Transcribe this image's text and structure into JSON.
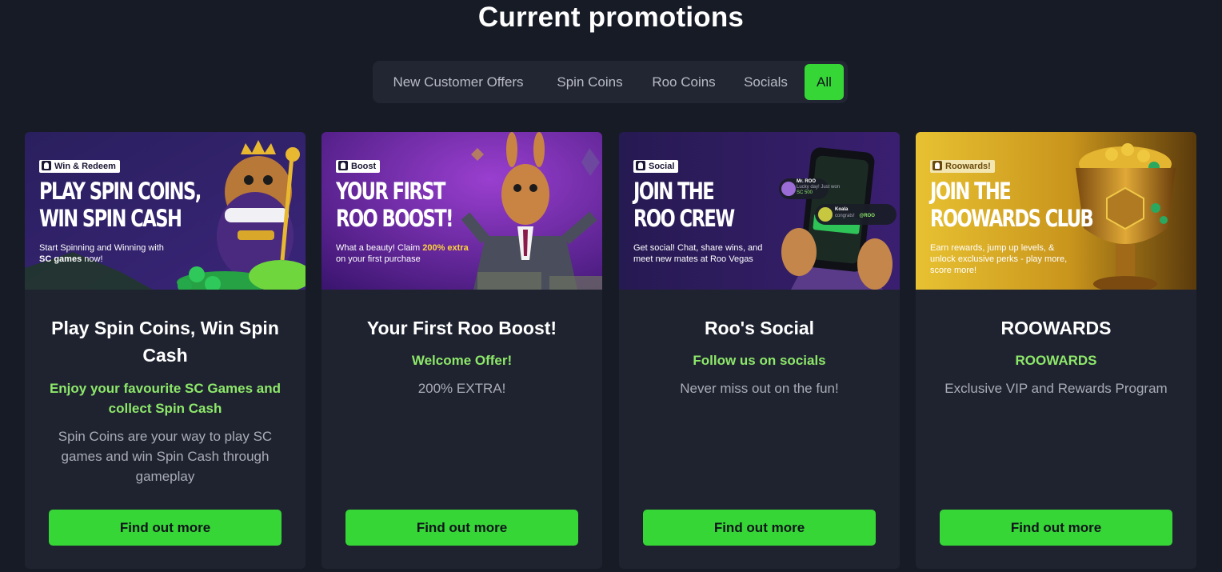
{
  "page": {
    "title": "Current promotions"
  },
  "tabs": [
    {
      "label": "New Customer Offers"
    },
    {
      "label": "Spin Coins"
    },
    {
      "label": "Roo Coins"
    },
    {
      "label": "Socials"
    },
    {
      "label": "All",
      "active": true
    }
  ],
  "cards": [
    {
      "banner": {
        "badge": "Win & Redeem",
        "headline_1": "PLAY SPIN COINS,",
        "headline_2": "WIN SPIN CASH",
        "blurb_1": "Start Spinning and Winning with",
        "blurb_2": "SC games",
        "blurb_3": "now!"
      },
      "title": "Play Spin Coins, Win Spin Cash",
      "subtitle": "Enjoy your favourite SC Games and collect Spin Cash",
      "description": "Spin Coins are your way to play SC games and win Spin Cash through gameplay",
      "button": "Find out more"
    },
    {
      "banner": {
        "badge": "Boost",
        "headline_1": "YOUR FIRST",
        "headline_2": "ROO BOOST!",
        "blurb_1": "What a beauty! Claim",
        "blurb_hl": "200% extra",
        "blurb_2": "on your first purchase"
      },
      "title": "Your First Roo Boost!",
      "subtitle": "Welcome Offer!",
      "description": "200% EXTRA!",
      "button": "Find out more"
    },
    {
      "banner": {
        "badge": "Social",
        "headline_1": "JOIN THE",
        "headline_2": "ROO CREW",
        "blurb_1": "Get social! Chat, share wins, and meet new mates at Roo Vegas",
        "phone_user_1": "Mr. ROO",
        "phone_msg_1": "Lucky day! Just won",
        "phone_val_1": "SC 500",
        "phone_user_2": "Koala",
        "phone_msg_2": "congrats!",
        "phone_tag": "@ROO"
      },
      "title": "Roo's Social",
      "subtitle": "Follow us on socials",
      "description": "Never miss out on the fun!",
      "button": "Find out more"
    },
    {
      "banner": {
        "badge": "Roowards!",
        "headline_1": "JOIN THE",
        "headline_2": "ROOWARDS CLUB",
        "blurb_1": "Earn rewards, jump up levels, & unlock exclusive perks - play more, score more!"
      },
      "title": "ROOWARDS",
      "subtitle": "ROOWARDS",
      "description": "Exclusive VIP and Rewards Program",
      "button": "Find out more"
    }
  ],
  "colors": {
    "accent": "#36d636",
    "subtitle": "#8de86a",
    "background": "#171b26",
    "card": "#1f2330"
  }
}
